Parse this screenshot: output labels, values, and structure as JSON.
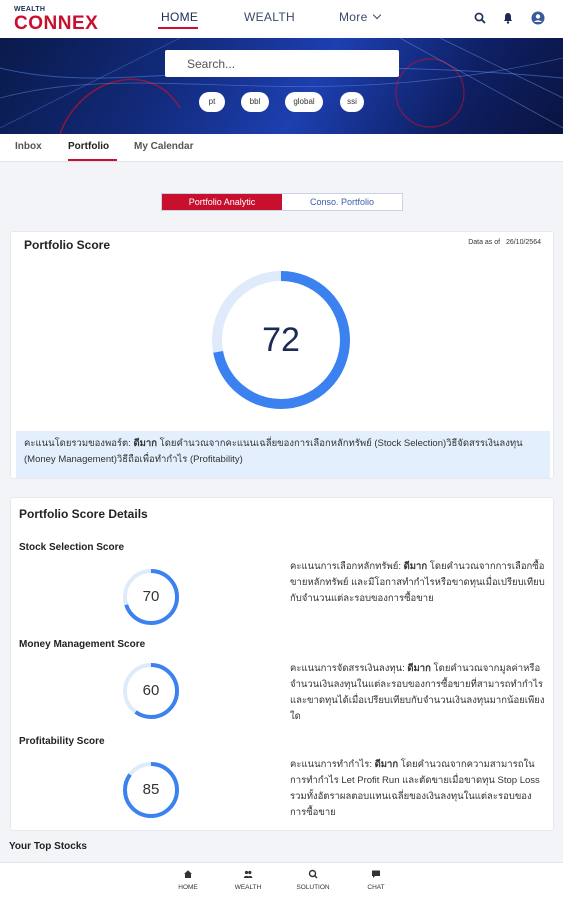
{
  "brand": {
    "small": "WEALTH",
    "big": "CONNEX"
  },
  "topnav": {
    "home": "HOME",
    "wealth": "WEALTH",
    "more": "More"
  },
  "search": {
    "placeholder": "Search..."
  },
  "chips": [
    "pt",
    "bbl",
    "global",
    "ssi"
  ],
  "tabs": [
    "Inbox",
    "Portfolio",
    "My Calendar"
  ],
  "toggle": {
    "option1": "Portfolio Analytic",
    "option2": "Conso. Portfolio"
  },
  "portfolio_score": {
    "title": "Portfolio Score",
    "data_as_of_label": "Data as of",
    "data_as_of_date": "26/10/2564",
    "score": "72",
    "score_fraction": 0.72,
    "note_prefix": "คะแนนโดยรวมของพอร์ต: ",
    "note_bold": "ดีมาก",
    "note_rest": " โดยคำนวณจากคะแนนเฉลี่ยของการเลือกหลักทรัพย์ (Stock Selection)วิธีจัดสรรเงินลงทุน (Money Management)วิธีถือเพื่อทำกำไร (Profitability)"
  },
  "details": {
    "title": "Portfolio Score Details",
    "items": [
      {
        "label": "Stock Selection Score",
        "score": "70",
        "fraction": 0.7,
        "desc_prefix": "คะแนนการเลือกหลักทรัพย์: ",
        "desc_bold": "ดีมาก",
        "desc_rest": " โดยคำนวณจากการเลือกซื้อขายหลักทรัพย์ และมีโอกาสทำกำไรหรือขาดทุนเมื่อเปรียบเทียบกับจำนวนแต่ละรอบของการซื้อขาย"
      },
      {
        "label": "Money Management Score",
        "score": "60",
        "fraction": 0.6,
        "desc_prefix": "คะแนนการจัดสรรเงินลงทุน: ",
        "desc_bold": "ดีมาก",
        "desc_rest": " โดยคำนวณจากมูลค่าหรือจำนวนเงินลงทุนในแต่ละรอบของการซื้อขายที่สามารถทำกำไรและขาดทุนได้เมื่อเปรียบเทียบกับจำนวนเงินลงทุนมากน้อยเพียงใด"
      },
      {
        "label": "Profitability Score",
        "score": "85",
        "fraction": 0.85,
        "desc_prefix": "คะแนนการทำกำไร: ",
        "desc_bold": "ดีมาก",
        "desc_rest": " โดยคำนวณจากความสามารถในการทำกำไร Let Profit Run และตัดขายเมื่อขาดทุน Stop Loss รวมทั้งอัตราผลตอบแทนเฉลี่ยของเงินลงทุนในแต่ละรอบของการซื้อขาย"
      }
    ]
  },
  "top_stocks": "Your Top Stocks",
  "bottomnav": [
    "HOME",
    "WEALTH",
    "SOLUTION",
    "CHAT"
  ],
  "colors": {
    "brand_red": "#c8102e",
    "ring_blue": "#3b82f0",
    "ring_track": "#dfeafb",
    "navy": "#1c2b55"
  }
}
